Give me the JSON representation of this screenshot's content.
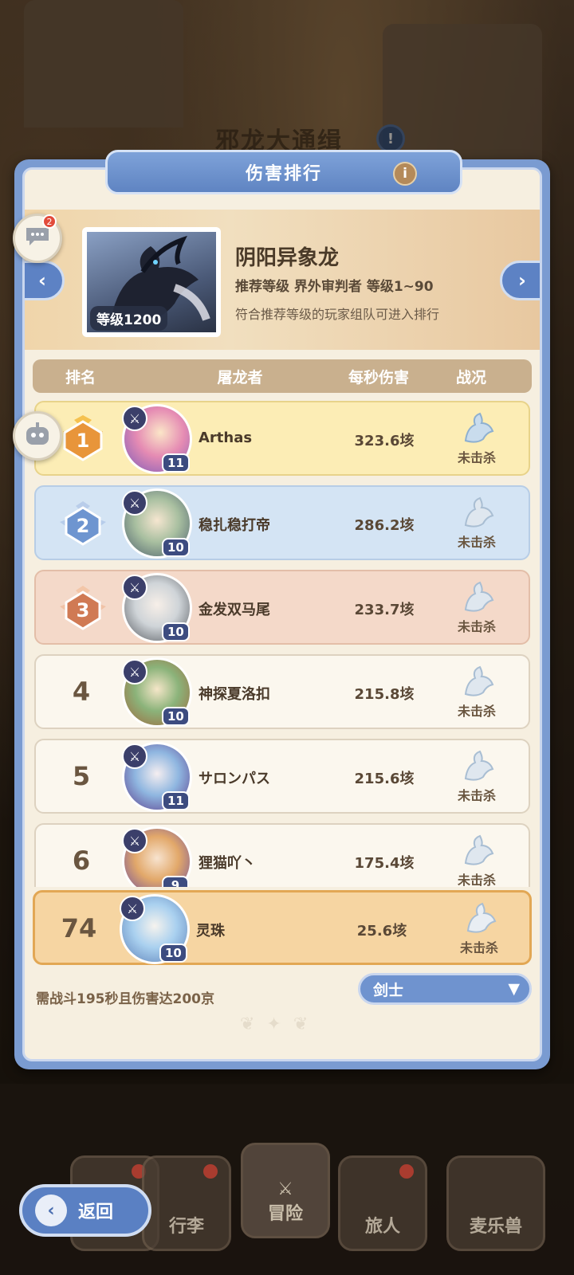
{
  "background": {
    "title": "邪龙大通缉"
  },
  "panel": {
    "title": "伤害排行",
    "info_icon": "info-icon"
  },
  "side_buttons": {
    "chat_badge": "2"
  },
  "boss": {
    "name": "阴阳异象龙",
    "level_label": "等级1200",
    "recommendation": "推荐等级  界外审判者  等级1~90",
    "hint": "符合推荐等级的玩家组队可进入排行"
  },
  "table": {
    "headers": [
      "排名",
      "屠龙者",
      "每秒伤害",
      "战况"
    ],
    "rows": [
      {
        "rank": "1",
        "name": "Arthas",
        "level": "11",
        "dps": "323.6垓",
        "status": "未击杀"
      },
      {
        "rank": "2",
        "name": "稳扎稳打帝",
        "level": "10",
        "dps": "286.2垓",
        "status": "未击杀"
      },
      {
        "rank": "3",
        "name": "金发双马尾",
        "level": "10",
        "dps": "233.7垓",
        "status": "未击杀"
      },
      {
        "rank": "4",
        "name": "神探夏洛扣",
        "level": "10",
        "dps": "215.8垓",
        "status": "未击杀"
      },
      {
        "rank": "5",
        "name": "サロンパス",
        "level": "11",
        "dps": "215.6垓",
        "status": "未击杀"
      },
      {
        "rank": "6",
        "name": "狸猫吖丶",
        "level": "9",
        "dps": "175.4垓",
        "status": "未击杀"
      }
    ]
  },
  "my_entry": {
    "rank": "74",
    "name": "灵珠",
    "level": "10",
    "dps": "25.6垓",
    "status": "未击杀"
  },
  "footer": {
    "requirement": "需战斗195秒且伤害达200京",
    "class_select": "剑士"
  },
  "bottom_nav": {
    "back": "返回",
    "items": [
      "行李",
      "冒险",
      "旅人",
      "麦乐兽"
    ]
  },
  "colors": {
    "panel_blue": "#7a9bd1",
    "gold_row": "#fcedb5",
    "silver_row": "#d4e4f4",
    "bronze_row": "#f4d9c9",
    "my_row": "#f6d5a2"
  }
}
